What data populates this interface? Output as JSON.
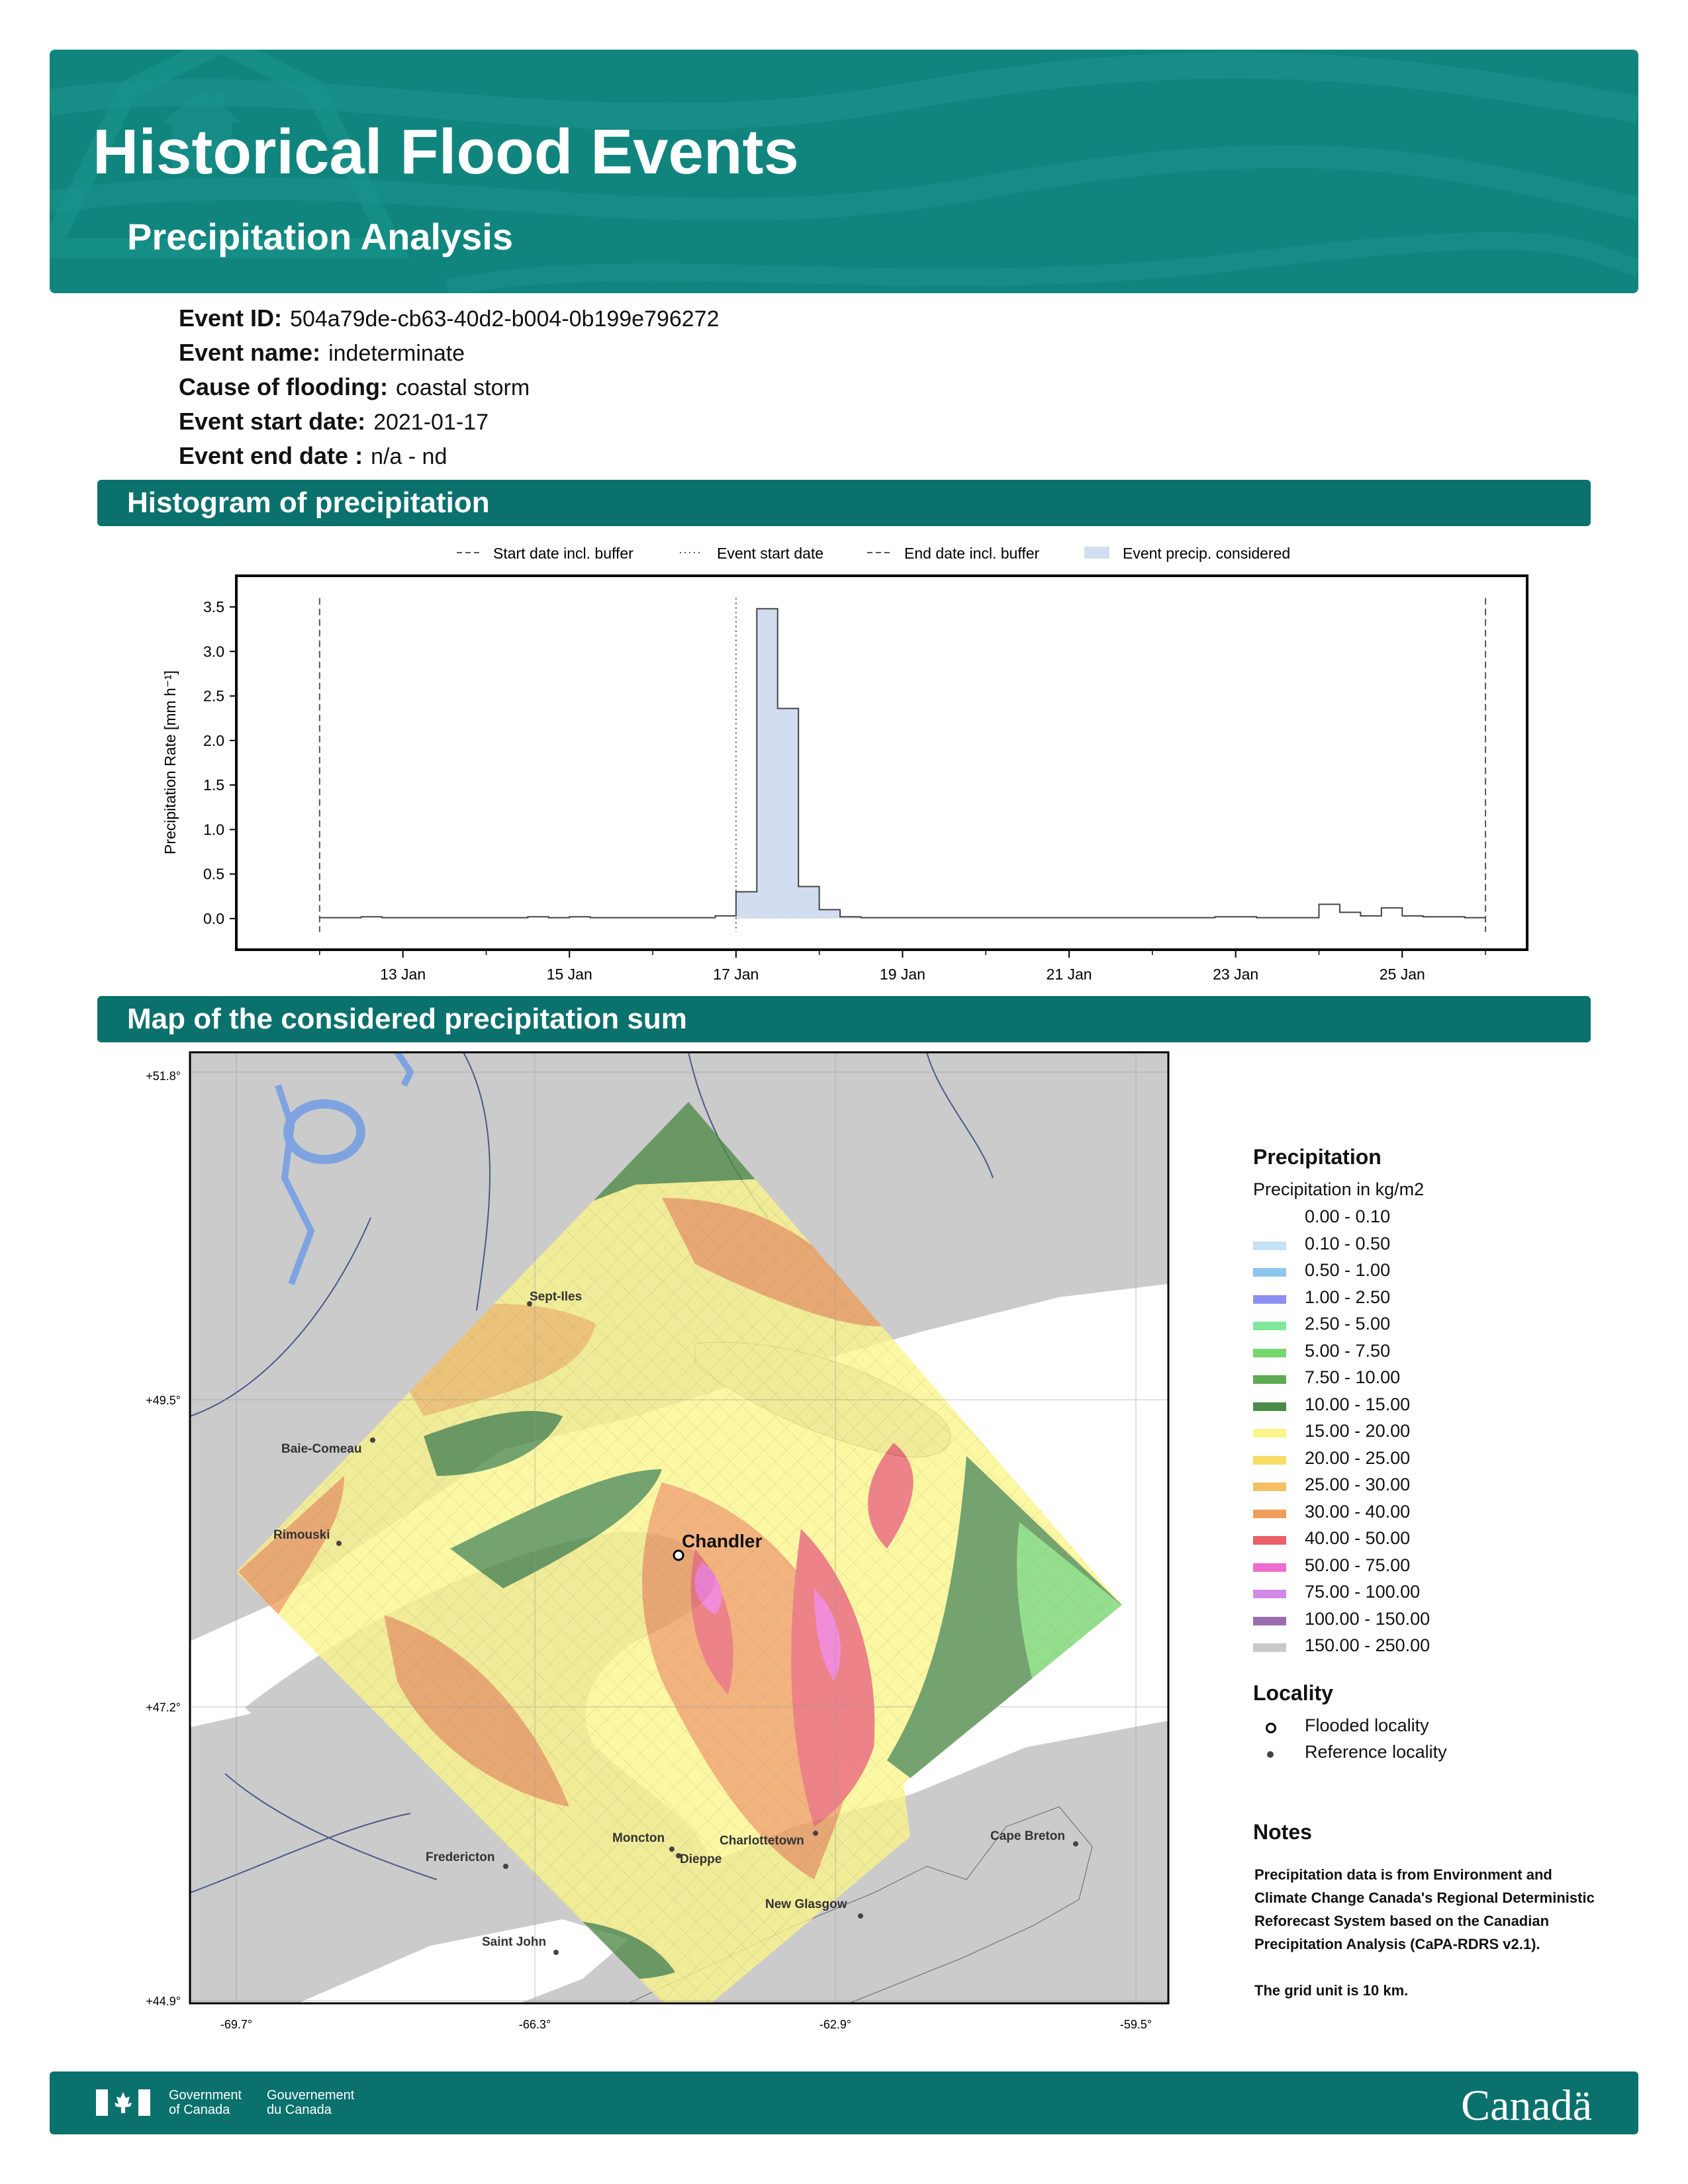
{
  "header": {
    "title": "Historical Flood Events",
    "subtitle": "Precipitation Analysis"
  },
  "event": {
    "fields": [
      {
        "label": "Event ID:",
        "value": "504a79de-cb63-40d2-b004-0b199e796272"
      },
      {
        "label": "Event name:",
        "value": "indeterminate"
      },
      {
        "label": "Cause of flooding:",
        "value": "coastal storm"
      },
      {
        "label": "Event start date:",
        "value": "2021-01-17"
      },
      {
        "label": "Event end date :",
        "value": "n/a - nd"
      }
    ]
  },
  "sections": {
    "histogram": "Histogram of precipitation",
    "map": "Map of the considered precipitation sum"
  },
  "chart_data": {
    "type": "bar",
    "ylabel": "Precipitation Rate [mm h⁻¹]",
    "ylim": [
      -0.35,
      3.85
    ],
    "yticks": [
      "0.0",
      "0.5",
      "1.0",
      "1.5",
      "2.0",
      "2.5",
      "3.0",
      "3.5"
    ],
    "x_range": [
      "2021-01-11",
      "2021-01-26T12:00"
    ],
    "xtick_dates": [
      "2021-01-13",
      "2021-01-15",
      "2021-01-17",
      "2021-01-19",
      "2021-01-21",
      "2021-01-23",
      "2021-01-25"
    ],
    "xtick_labels": [
      "13 Jan",
      "15 Jan",
      "17 Jan",
      "19 Jan",
      "21 Jan",
      "23 Jan",
      "25 Jan"
    ],
    "bin_hours": 6,
    "x": [
      "2021-01-12T00",
      "2021-01-12T06",
      "2021-01-12T12",
      "2021-01-12T18",
      "2021-01-13T00",
      "2021-01-13T06",
      "2021-01-13T12",
      "2021-01-13T18",
      "2021-01-14T00",
      "2021-01-14T06",
      "2021-01-14T12",
      "2021-01-14T18",
      "2021-01-15T00",
      "2021-01-15T06",
      "2021-01-15T12",
      "2021-01-15T18",
      "2021-01-16T00",
      "2021-01-16T06",
      "2021-01-16T12",
      "2021-01-16T18",
      "2021-01-17T00",
      "2021-01-17T06",
      "2021-01-17T12",
      "2021-01-17T18",
      "2021-01-18T00",
      "2021-01-18T06",
      "2021-01-18T12",
      "2021-01-18T18",
      "2021-01-19T00",
      "2021-01-19T06",
      "2021-01-19T12",
      "2021-01-19T18",
      "2021-01-20T00",
      "2021-01-20T06",
      "2021-01-20T12",
      "2021-01-20T18",
      "2021-01-21T00",
      "2021-01-21T06",
      "2021-01-21T12",
      "2021-01-21T18",
      "2021-01-22T00",
      "2021-01-22T06",
      "2021-01-22T12",
      "2021-01-22T18",
      "2021-01-23T00",
      "2021-01-23T06",
      "2021-01-23T12",
      "2021-01-23T18",
      "2021-01-24T00",
      "2021-01-24T06",
      "2021-01-24T12",
      "2021-01-24T18",
      "2021-01-25T00",
      "2021-01-25T06",
      "2021-01-25T12",
      "2021-01-25T18"
    ],
    "values": [
      0.01,
      0.01,
      0.02,
      0.01,
      0.01,
      0.01,
      0.01,
      0.01,
      0.01,
      0.01,
      0.02,
      0.01,
      0.02,
      0.01,
      0.01,
      0.01,
      0.01,
      0.01,
      0.01,
      0.03,
      0.3,
      3.48,
      2.36,
      0.36,
      0.1,
      0.02,
      0.01,
      0.01,
      0.01,
      0.01,
      0.01,
      0.01,
      0.01,
      0.01,
      0.01,
      0.01,
      0.01,
      0.01,
      0.01,
      0.01,
      0.01,
      0.01,
      0.01,
      0.02,
      0.02,
      0.01,
      0.01,
      0.01,
      0.16,
      0.07,
      0.03,
      0.12,
      0.03,
      0.02,
      0.02,
      0.01
    ],
    "considered_range": [
      "2021-01-17T00",
      "2021-01-18T06"
    ],
    "vlines": [
      {
        "date": "2021-01-12T00",
        "style": "dashed"
      },
      {
        "date": "2021-01-17T00",
        "style": "dotted"
      },
      {
        "date": "2021-01-26T00",
        "style": "dashed"
      }
    ],
    "legend": [
      "Start date incl. buffer",
      "Event start date",
      "End date incl. buffer",
      "Event precip. considered"
    ],
    "legend_position": "top",
    "colors": {
      "fill": "#d3ddf0",
      "edge": "#444444",
      "vline": "#555555"
    }
  },
  "map": {
    "lat_labels": [
      "+51.8°",
      "+49.5°",
      "+47.2°",
      "+44.9°"
    ],
    "lon_labels": [
      "-69.7°",
      "-66.3°",
      "-62.9°",
      "-59.5°"
    ],
    "flooded_locality": "Chandler",
    "localities": [
      "Sept-Iles",
      "Baie-Comeau",
      "Rimouski",
      "Moncton",
      "Dieppe",
      "Charlottetown",
      "Fredericton",
      "Saint John",
      "New Glasgow",
      "Cape Breton"
    ]
  },
  "legend": {
    "precip_title": "Precipitation",
    "precip_subtitle": "Precipitation in kg/m2",
    "classes": [
      {
        "label": "0.00 - 0.10",
        "color": "#ffffff"
      },
      {
        "label": "0.10 - 0.50",
        "color": "#c6e2f6"
      },
      {
        "label": "0.50 - 1.00",
        "color": "#8ec6f0"
      },
      {
        "label": "1.00 - 2.50",
        "color": "#8d8ff2"
      },
      {
        "label": "2.50 - 5.00",
        "color": "#7fe89b"
      },
      {
        "label": "5.00 - 7.50",
        "color": "#76d66e"
      },
      {
        "label": "7.50 - 10.00",
        "color": "#5faa55"
      },
      {
        "label": "10.00 - 15.00",
        "color": "#4d8a47"
      },
      {
        "label": "15.00 - 20.00",
        "color": "#fbf58a"
      },
      {
        "label": "20.00 - 25.00",
        "color": "#f7dc65"
      },
      {
        "label": "25.00 - 30.00",
        "color": "#f5c064"
      },
      {
        "label": "30.00 - 40.00",
        "color": "#ef9e5c"
      },
      {
        "label": "40.00 - 50.00",
        "color": "#e96067"
      },
      {
        "label": "50.00 - 75.00",
        "color": "#ef6ccf"
      },
      {
        "label": "75.00 - 100.00",
        "color": "#cf8ae6"
      },
      {
        "label": "100.00 - 150.00",
        "color": "#9b6fae"
      },
      {
        "label": "150.00 - 250.00",
        "color": "#c9c9c9"
      }
    ],
    "locality_title": "Locality",
    "flooded_label": "Flooded locality",
    "reference_label": "Reference locality",
    "notes_title": "Notes",
    "notes_text": "Precipitation data is from Environment and Climate Change Canada's Regional Deterministic Reforecast System based on the Canadian Precipitation Analysis (CaPA-RDRS v2.1).",
    "notes_grid": "The grid unit is 10 km."
  },
  "footer": {
    "gov_en_1": "Government",
    "gov_en_2": "of Canada",
    "gov_fr_1": "Gouvernement",
    "gov_fr_2": "du Canada",
    "wordmark": "Canadä"
  }
}
